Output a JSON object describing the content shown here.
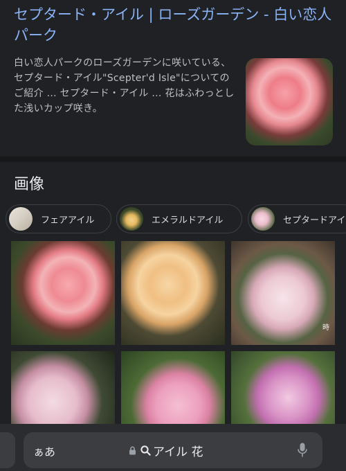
{
  "result": {
    "title": "セプタード・アイル | ローズガーデン - 白い恋人パーク",
    "snippet": "白い恋人パークのローズガーデンに咲いている、セプタード・アイル\"Scepter'd Isle\"についてのご紹介 ... セプタード・アイル ... 花はふわっとした浅いカップ咲き。"
  },
  "images_section": {
    "heading": "画像",
    "chips": [
      {
        "label": "フェアアイル"
      },
      {
        "label": "エメラルドアイル"
      },
      {
        "label": "セプタードアイル"
      }
    ],
    "watermark": "時"
  },
  "address_bar": {
    "aa_label": "ぁあ",
    "url_text": "アイル 花",
    "icons": [
      "lock-icon",
      "search-icon",
      "microphone-icon"
    ]
  },
  "colors": {
    "background": "#202124",
    "link": "#8ab4f8",
    "snippet": "#bdc1c6"
  }
}
